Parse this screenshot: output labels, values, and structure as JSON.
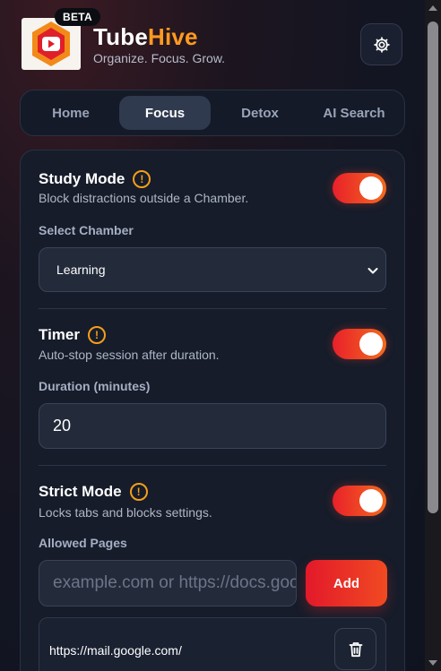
{
  "header": {
    "beta_badge": "BETA",
    "brand_part1": "Tube",
    "brand_part2": "Hive",
    "tagline": "Organize. Focus. Grow.",
    "accent_color": "#ff9a1f"
  },
  "tabs": [
    {
      "label": "Home",
      "active": false
    },
    {
      "label": "Focus",
      "active": true
    },
    {
      "label": "Detox",
      "active": false
    },
    {
      "label": "AI Search",
      "active": false
    }
  ],
  "study_mode": {
    "title": "Study Mode",
    "description": "Block distractions outside a Chamber.",
    "enabled": true,
    "select_label": "Select Chamber",
    "selected_chamber": "Learning"
  },
  "timer": {
    "title": "Timer",
    "description": "Auto-stop session after duration.",
    "enabled": true,
    "duration_label": "Duration (minutes)",
    "duration_value": "20"
  },
  "strict_mode": {
    "title": "Strict Mode",
    "description": "Locks tabs and blocks settings.",
    "enabled": true,
    "allowed_label": "Allowed Pages",
    "input_placeholder": "example.com or https://docs.google.com",
    "add_label": "Add",
    "allowed_pages": [
      "https://mail.google.com/"
    ]
  },
  "icons": {
    "settings": "gear-icon",
    "warning": "exclamation-circle-icon",
    "delete": "trash-icon",
    "dropdown": "chevron-down-icon"
  },
  "colors": {
    "toggle_on_start": "#e8202a",
    "toggle_on_end": "#f56a1e",
    "add_button": "#e3192a"
  }
}
